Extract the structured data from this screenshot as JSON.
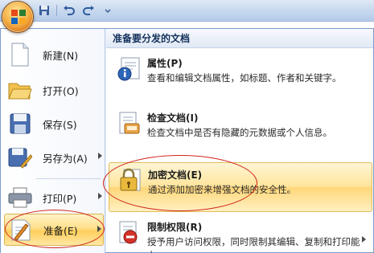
{
  "menu_header": "准备要分发的文档",
  "left_commands": [
    {
      "label": "新建(N)",
      "icon": "new-document-icon"
    },
    {
      "label": "打开(O)",
      "icon": "open-folder-icon"
    },
    {
      "label": "保存(S)",
      "icon": "save-icon"
    },
    {
      "label": "另存为(A)",
      "icon": "save-as-icon"
    },
    {
      "label": "打印(P)",
      "icon": "print-icon"
    },
    {
      "label": "准备(E)",
      "icon": "prepare-icon"
    }
  ],
  "prepare_items": [
    {
      "title": "属性(P)",
      "desc": "查看和编辑文档属性，如标题、作者和关键字。",
      "icon": "properties-icon"
    },
    {
      "title": "检查文档(I)",
      "desc": "检查文档中是否有隐藏的元数据或个人信息。",
      "icon": "inspect-document-icon"
    },
    {
      "title": "加密文档(E)",
      "desc": "通过添加加密来增强文档的安全性。",
      "icon": "encrypt-lock-icon"
    },
    {
      "title": "限制权限(R)",
      "desc": "授予用户访问权限，同时限制其编辑、复制和打印能力。",
      "icon": "restrict-permission-icon"
    }
  ],
  "colors": {
    "accent_ring": "#d2261c",
    "highlight": "#ffd77a",
    "menu_border": "#7c9ccd"
  }
}
